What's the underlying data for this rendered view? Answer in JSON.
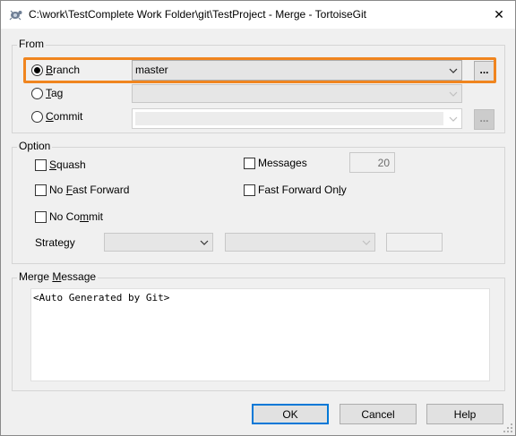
{
  "window": {
    "title": "C:\\work\\TestComplete Work Folder\\git\\TestProject - Merge - TortoiseGit",
    "close_glyph": "✕"
  },
  "from": {
    "legend": "From",
    "branch_label": "Branch",
    "tag_label": "Tag",
    "commit_label": "Commit",
    "branch_value": "master",
    "browse_glyph": "...",
    "selected": "Branch",
    "highlight_color": "#f0851f"
  },
  "option": {
    "legend": "Option",
    "squash_label": "Squash",
    "no_fast_forward_label": "No Fast Forward",
    "no_commit_label": "No Commit",
    "messages_label": "Messages",
    "messages_count": "20",
    "fast_forward_only_label": "Fast Forward Only",
    "strategy_label": "Strategy"
  },
  "merge_message": {
    "legend": "Merge Message",
    "text": "<Auto Generated by Git>"
  },
  "buttons": {
    "ok": "OK",
    "cancel": "Cancel",
    "help": "Help"
  },
  "colors": {
    "accent": "#0078d7",
    "highlight": "#f0851f"
  }
}
